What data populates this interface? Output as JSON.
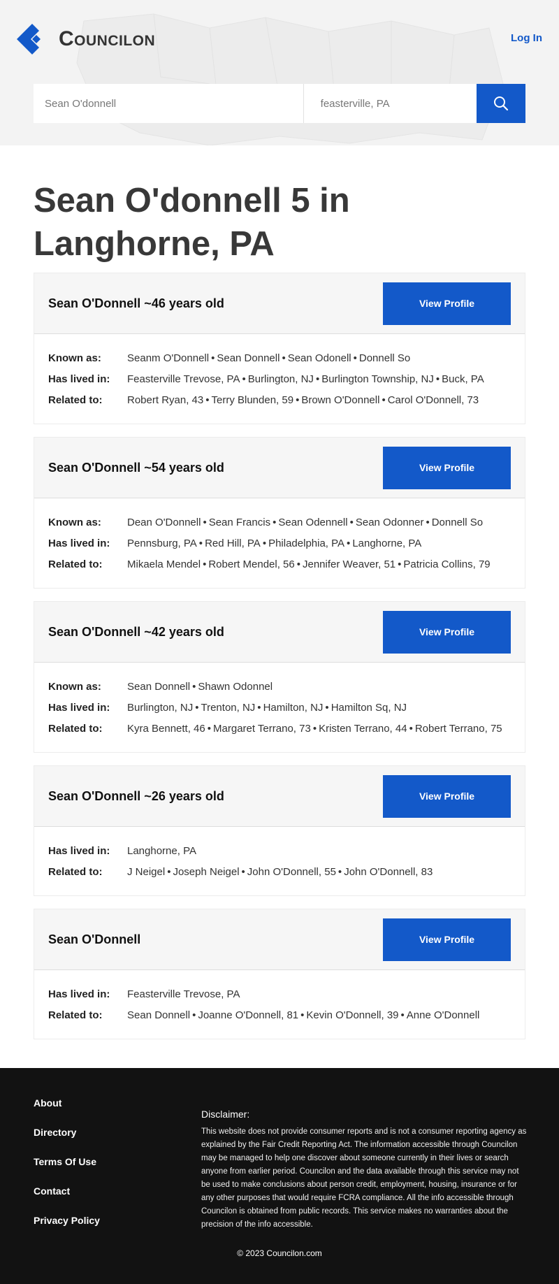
{
  "header": {
    "brand": "Councilon",
    "login_label": "Log In",
    "search": {
      "name_value": "Sean O'donnell",
      "location_value": "feasterville, PA"
    }
  },
  "page_title": "Sean O'donnell 5 in Langhorne, PA",
  "labels": {
    "known_as": "Known as:",
    "has_lived_in": "Has lived in:",
    "related_to": "Related to:",
    "view_profile": "View Profile"
  },
  "results": [
    {
      "name": "Sean O'Donnell ~46 years old",
      "known_as": [
        "Seanm O'Donnell",
        "Sean Donnell",
        "Sean Odonell",
        "Donnell So"
      ],
      "has_lived_in": [
        "Feasterville Trevose, PA",
        "Burlington, NJ",
        "Burlington Township, NJ",
        "Buck, PA"
      ],
      "related_to": [
        "Robert Ryan, 43",
        "Terry Blunden, 59",
        "Brown O'Donnell",
        "Carol O'Donnell, 73"
      ]
    },
    {
      "name": "Sean O'Donnell ~54 years old",
      "known_as": [
        "Dean O'Donnell",
        "Sean Francis",
        "Sean Odennell",
        "Sean Odonner",
        "Donnell So"
      ],
      "has_lived_in": [
        "Pennsburg, PA",
        "Red Hill, PA",
        "Philadelphia, PA",
        "Langhorne, PA"
      ],
      "related_to": [
        "Mikaela Mendel",
        "Robert Mendel, 56",
        "Jennifer Weaver, 51",
        "Patricia Collins, 79"
      ]
    },
    {
      "name": "Sean O'Donnell ~42 years old",
      "known_as": [
        "Sean Donnell",
        "Shawn Odonnel"
      ],
      "has_lived_in": [
        "Burlington, NJ",
        "Trenton, NJ",
        "Hamilton, NJ",
        "Hamilton Sq, NJ"
      ],
      "related_to": [
        "Kyra Bennett, 46",
        "Margaret Terrano, 73",
        "Kristen Terrano, 44",
        "Robert Terrano, 75"
      ]
    },
    {
      "name": "Sean O'Donnell ~26 years old",
      "known_as": [],
      "has_lived_in": [
        "Langhorne, PA"
      ],
      "related_to": [
        "J Neigel",
        "Joseph Neigel",
        "John O'Donnell, 55",
        "John O'Donnell, 83"
      ]
    },
    {
      "name": "Sean O'Donnell",
      "known_as": [],
      "has_lived_in": [
        "Feasterville Trevose, PA"
      ],
      "related_to": [
        "Sean Donnell",
        "Joanne O'Donnell, 81",
        "Kevin O'Donnell, 39",
        "Anne O'Donnell"
      ]
    }
  ],
  "footer": {
    "links": [
      "About",
      "Directory",
      "Terms Of Use",
      "Contact",
      "Privacy Policy"
    ],
    "disclaimer_title": "Disclaimer:",
    "disclaimer_text": "This website does not provide consumer reports and is not a consumer reporting agency as explained by the Fair Credit Reporting Act. The information accessible through Councilon may be managed to help one discover about someone currently in their lives or search anyone from earlier period. Councilon and the data available through this service may not be used to make conclusions about person credit, employment, housing, insurance or for any other purposes that would require FCRA compliance. All the info accessible through Councilon is obtained from public records. This service makes no warranties about the precision of the info accessible.",
    "copyright": "© 2023 Councilon.com"
  },
  "colors": {
    "accent": "#1359c9",
    "footer_bg": "#121212",
    "card_head_bg": "#f6f6f6"
  },
  "icons": {
    "logo": "councilon-logo-icon",
    "search": "search-icon"
  }
}
